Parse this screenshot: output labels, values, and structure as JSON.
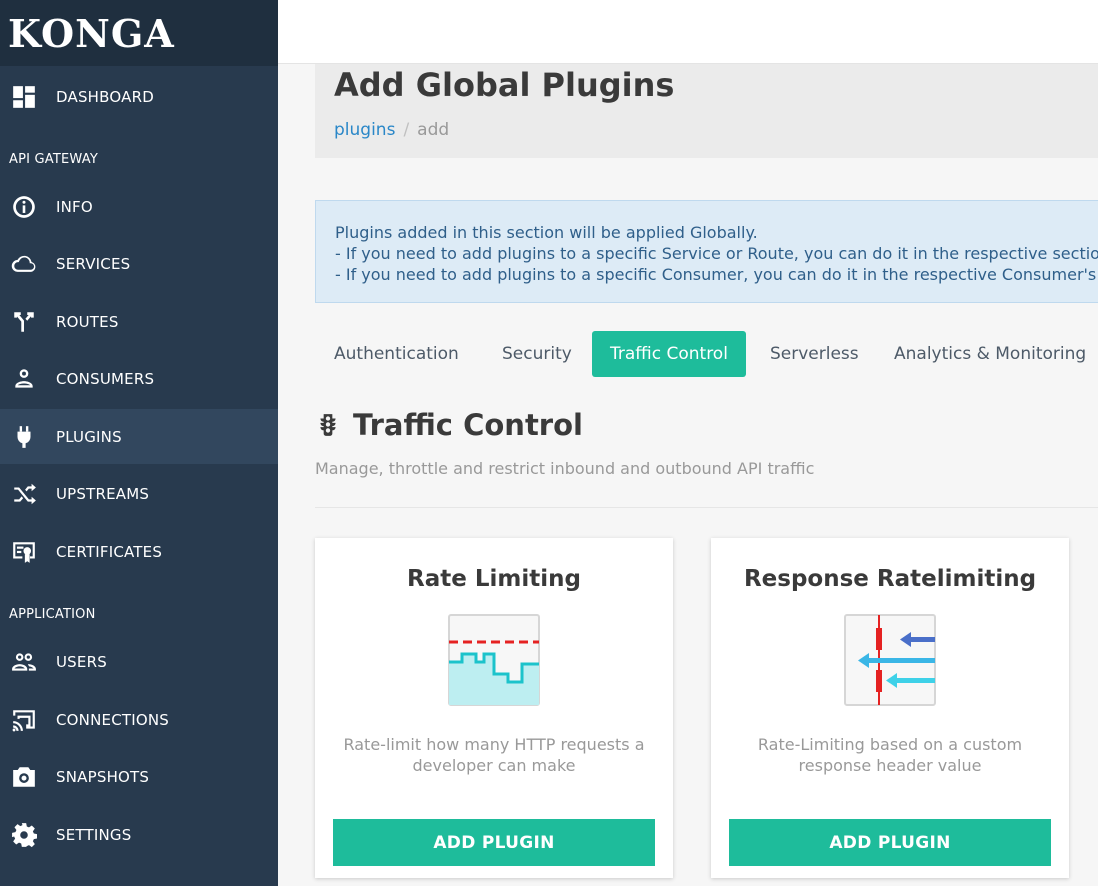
{
  "brand": "KONGA",
  "nav": {
    "dashboard": "DASHBOARD",
    "section_api": "API GATEWAY",
    "info": "INFO",
    "services": "SERVICES",
    "routes": "ROUTES",
    "consumers": "CONSUMERS",
    "plugins": "PLUGINS",
    "upstreams": "UPSTREAMS",
    "certificates": "CERTIFICATES",
    "section_app": "APPLICATION",
    "users": "USERS",
    "connections": "CONNECTIONS",
    "snapshots": "SNAPSHOTS",
    "settings": "SETTINGS",
    "active_item": "PLUGINS"
  },
  "page": {
    "title": "Add Global Plugins",
    "breadcrumb": {
      "link": "plugins",
      "separator": "/",
      "current": "add"
    }
  },
  "alert": {
    "line1": "Plugins added in this section will be applied Globally.",
    "line2": "- If you need to add plugins to a specific Service or Route, you can do it in the respective section.",
    "line3": "- If you need to add plugins to a specific Consumer, you can do it in the respective Consumer's page."
  },
  "tabs": [
    "Authentication",
    "Security",
    "Traffic Control",
    "Serverless",
    "Analytics & Monitoring"
  ],
  "active_tab": "Traffic Control",
  "section": {
    "icon": "traffic-light-icon",
    "title": "Traffic Control",
    "description": "Manage, throttle and restrict inbound and outbound API traffic"
  },
  "cards": [
    {
      "title": "Rate Limiting",
      "icon": "rate-limiting-icon",
      "description": "Rate-limit how many HTTP requests a developer can make",
      "button": "ADD PLUGIN"
    },
    {
      "title": "Response Ratelimiting",
      "icon": "response-ratelimiting-icon",
      "description": "Rate-Limiting based on a custom response header value",
      "button": "ADD PLUGIN"
    }
  ],
  "colors": {
    "sidebar": "#283a4e",
    "sidebar_active": "#32475e",
    "accent": "#1ebc9b",
    "link": "#2a87c8",
    "alert_bg": "#ddebf6",
    "alert_text": "#2f5f8a"
  }
}
